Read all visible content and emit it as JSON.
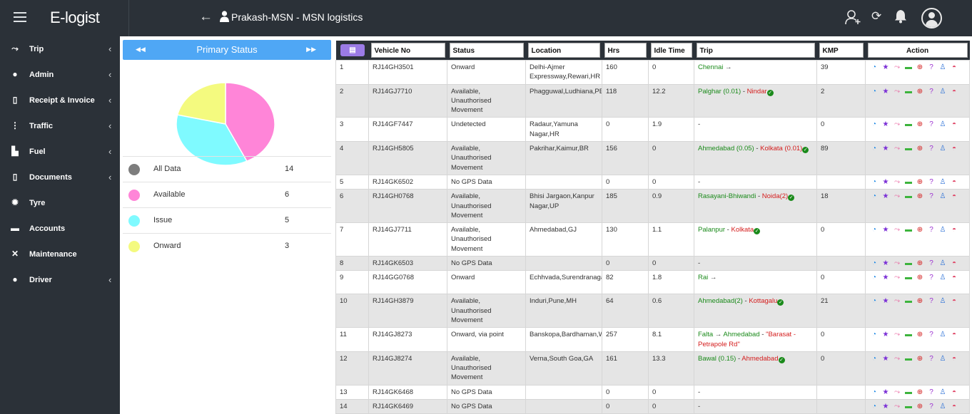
{
  "app": {
    "logo": "E-logist",
    "title": "Prakash-MSN - MSN logistics"
  },
  "sidebar": {
    "items": [
      {
        "label": "Trip",
        "icon": "route-icon",
        "has_children": true
      },
      {
        "label": "Admin",
        "icon": "user-icon",
        "has_children": true
      },
      {
        "label": "Receipt & Invoice",
        "icon": "document-icon",
        "has_children": true
      },
      {
        "label": "Traffic",
        "icon": "traffic-light-icon",
        "has_children": true
      },
      {
        "label": "Fuel",
        "icon": "fuel-pump-icon",
        "has_children": true
      },
      {
        "label": "Documents",
        "icon": "document-icon",
        "has_children": true
      },
      {
        "label": "Tyre",
        "icon": "gear-icon",
        "has_children": false
      },
      {
        "label": "Accounts",
        "icon": "credit-card-icon",
        "has_children": false
      },
      {
        "label": "Maintenance",
        "icon": "tools-icon",
        "has_children": false
      },
      {
        "label": "Driver",
        "icon": "user-icon",
        "has_children": true
      }
    ]
  },
  "status_panel": {
    "title": "Primary Status",
    "legend": [
      {
        "name": "All Data",
        "count": "14",
        "color": "#7d7d7d"
      },
      {
        "name": "Available",
        "count": "6",
        "color": "#ff85d8"
      },
      {
        "name": "Issue",
        "count": "5",
        "color": "#7ffaff"
      },
      {
        "name": "Onward",
        "count": "3",
        "color": "#f4fa7f"
      }
    ]
  },
  "chart_data": {
    "type": "pie",
    "categories": [
      "Available",
      "Issue",
      "Onward"
    ],
    "values": [
      6,
      5,
      3
    ],
    "colors": [
      "#ff85d8",
      "#7ffaff",
      "#f4fa7f"
    ]
  },
  "table": {
    "headers": {
      "vehicle": "Vehicle No",
      "status": "Status",
      "location": "Location",
      "hrs": "Hrs",
      "idle": "Idle Time",
      "trip": "Trip",
      "kmp": "KMP",
      "action": "Action"
    },
    "rows": [
      {
        "n": "1",
        "vehicle": "RJ14GH3501",
        "status": "Onward",
        "location": "Delhi-Ajmer Expressway,Rewari,HR",
        "hrs": "160",
        "idle": "0",
        "trip": [
          {
            "t": "Chennai",
            "c": "green"
          },
          {
            "t": " →",
            "c": "plain"
          }
        ],
        "kmp": "39"
      },
      {
        "n": "2",
        "vehicle": "RJ14GJ7710",
        "status": "Available, Unauthorised Movement",
        "location": "Phagguwal,Ludhiana,PB",
        "hrs": "118",
        "idle": "12.2",
        "trip": [
          {
            "t": "Palghar (0.01)",
            "c": "green"
          },
          {
            "t": " - ",
            "c": "plain"
          },
          {
            "t": "Nindar",
            "c": "red"
          },
          {
            "t": "check",
            "c": "ok"
          }
        ],
        "kmp": "2"
      },
      {
        "n": "3",
        "vehicle": "RJ14GF7447",
        "status": "Undetected",
        "location": "Radaur,Yamuna Nagar,HR",
        "hrs": "0",
        "idle": "1.9",
        "trip": [
          {
            "t": "-",
            "c": "plain"
          }
        ],
        "kmp": "0"
      },
      {
        "n": "4",
        "vehicle": "RJ14GH5805",
        "status": "Available, Unauthorised Movement",
        "location": "Pakrihar,Kaimur,BR",
        "hrs": "156",
        "idle": "0",
        "trip": [
          {
            "t": "Ahmedabad (0.05)",
            "c": "green"
          },
          {
            "t": " - ",
            "c": "plain"
          },
          {
            "t": "Kolkata (0.01)",
            "c": "red"
          },
          {
            "t": "check",
            "c": "ok"
          }
        ],
        "kmp": "89"
      },
      {
        "n": "5",
        "vehicle": "RJ14GK6502",
        "status": "No GPS Data",
        "location": "",
        "hrs": "0",
        "idle": "0",
        "trip": [
          {
            "t": "-",
            "c": "plain"
          }
        ],
        "kmp": ""
      },
      {
        "n": "6",
        "vehicle": "RJ14GH0768",
        "status": "Available, Unauthorised Movement",
        "location": "Bhisi Jargaon,Kanpur Nagar,UP",
        "hrs": "185",
        "idle": "0.9",
        "trip": [
          {
            "t": "Rasayani-Bhiwandi",
            "c": "green"
          },
          {
            "t": " - ",
            "c": "plain"
          },
          {
            "t": "Noida(2)",
            "c": "red"
          },
          {
            "t": "check",
            "c": "ok"
          }
        ],
        "kmp": "18"
      },
      {
        "n": "7",
        "vehicle": "RJ14GJ7711",
        "status": "Available, Unauthorised Movement",
        "location": "Ahmedabad,GJ",
        "hrs": "130",
        "idle": "1.1",
        "trip": [
          {
            "t": "Palanpur",
            "c": "green"
          },
          {
            "t": " - ",
            "c": "plain"
          },
          {
            "t": "Kolkata",
            "c": "red"
          },
          {
            "t": "check",
            "c": "ok"
          }
        ],
        "kmp": "0"
      },
      {
        "n": "8",
        "vehicle": "RJ14GK6503",
        "status": "No GPS Data",
        "location": "",
        "hrs": "0",
        "idle": "0",
        "trip": [
          {
            "t": "-",
            "c": "plain"
          }
        ],
        "kmp": ""
      },
      {
        "n": "9",
        "vehicle": "RJ14GG0768",
        "status": "Onward",
        "location": "Echhvada,Surendranagar,GJ",
        "hrs": "82",
        "idle": "1.8",
        "trip": [
          {
            "t": "Rai",
            "c": "green"
          },
          {
            "t": " →",
            "c": "plain"
          }
        ],
        "kmp": "0"
      },
      {
        "n": "10",
        "vehicle": "RJ14GH3879",
        "status": "Available, Unauthorised Movement",
        "location": "Induri,Pune,MH",
        "hrs": "64",
        "idle": "0.6",
        "trip": [
          {
            "t": "Ahmedabad(2)",
            "c": "green"
          },
          {
            "t": " - ",
            "c": "plain"
          },
          {
            "t": "Kottagalu",
            "c": "red"
          },
          {
            "t": "check",
            "c": "ok"
          }
        ],
        "kmp": "21"
      },
      {
        "n": "11",
        "vehicle": "RJ14GJ8273",
        "status": "Onward, via point",
        "location": "Banskopa,Bardhaman,WB",
        "hrs": "257",
        "idle": "8.1",
        "trip": [
          {
            "t": "Falta",
            "c": "green"
          },
          {
            "t": " → ",
            "c": "plain"
          },
          {
            "t": "Ahmedabad",
            "c": "green"
          },
          {
            "t": " - ",
            "c": "plain"
          },
          {
            "t": "\"Barasat - Petrapole Rd\"",
            "c": "red"
          }
        ],
        "kmp": "0"
      },
      {
        "n": "12",
        "vehicle": "RJ14GJ8274",
        "status": "Available, Unauthorised Movement",
        "location": "Verna,South Goa,GA",
        "hrs": "161",
        "idle": "13.3",
        "trip": [
          {
            "t": "Bawal (0.15)",
            "c": "green"
          },
          {
            "t": " - ",
            "c": "plain"
          },
          {
            "t": "Ahmedabad",
            "c": "red"
          },
          {
            "t": "check",
            "c": "ok"
          }
        ],
        "kmp": "0"
      },
      {
        "n": "13",
        "vehicle": "RJ14GK6468",
        "status": "No GPS Data",
        "location": "",
        "hrs": "0",
        "idle": "0",
        "trip": [
          {
            "t": "-",
            "c": "plain"
          }
        ],
        "kmp": ""
      },
      {
        "n": "14",
        "vehicle": "RJ14GK6469",
        "status": "No GPS Data",
        "location": "",
        "hrs": "0",
        "idle": "0",
        "trip": [
          {
            "t": "-",
            "c": "plain"
          }
        ],
        "kmp": ""
      }
    ],
    "action_icons": [
      {
        "name": "pie-chart-icon",
        "glyph": "◔",
        "color": "#1e88e5"
      },
      {
        "name": "star-icon",
        "glyph": "★",
        "color": "#7b2fd6"
      },
      {
        "name": "route-icon",
        "glyph": "⤳",
        "color": "#e85a9a"
      },
      {
        "name": "truck-icon",
        "glyph": "▬",
        "color": "#3cb43c"
      },
      {
        "name": "globe-icon",
        "glyph": "⊕",
        "color": "#d42020"
      },
      {
        "name": "help-icon",
        "glyph": "?",
        "color": "#9b30d0"
      },
      {
        "name": "driver-icon",
        "glyph": "♙",
        "color": "#2a6fd6"
      },
      {
        "name": "speedometer-icon",
        "glyph": "◓",
        "color": "#e04a6a"
      }
    ]
  }
}
